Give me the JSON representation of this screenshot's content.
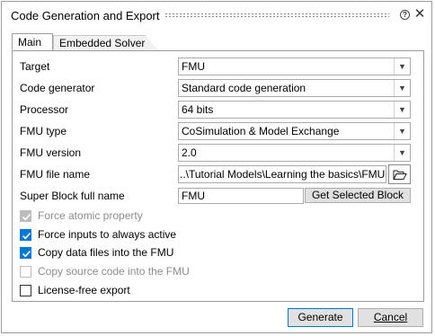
{
  "dialog": {
    "title": "Code Generation and Export",
    "help_icon": "question-circle-icon",
    "close_icon": "close-icon"
  },
  "tabs": [
    {
      "label": "Main",
      "active": true
    },
    {
      "label": "Embedded Solver",
      "active": false
    }
  ],
  "fields": {
    "target": {
      "label": "Target",
      "value": "FMU"
    },
    "code_generator": {
      "label": "Code generator",
      "value": "Standard code generation"
    },
    "processor": {
      "label": "Processor",
      "value": "64 bits"
    },
    "fmu_type": {
      "label": "FMU type",
      "value": "CoSimulation & Model Exchange"
    },
    "fmu_version": {
      "label": "FMU version",
      "value": "2.0"
    },
    "fmu_file_name": {
      "label": "FMU file name",
      "value": "..\\Tutorial Models\\Learning the basics\\FMU.fmu"
    },
    "super_block": {
      "label": "Super Block full name",
      "value": "FMU",
      "button": "Get Selected Block"
    }
  },
  "options": [
    {
      "label": "Force atomic property",
      "checked": true,
      "enabled": false
    },
    {
      "label": "Force inputs to always active",
      "checked": true,
      "enabled": true
    },
    {
      "label": "Copy data files into the FMU",
      "checked": true,
      "enabled": true
    },
    {
      "label": "Copy source code into the FMU",
      "checked": false,
      "enabled": false
    },
    {
      "label": "License-free export",
      "checked": false,
      "enabled": true
    }
  ],
  "footer": {
    "generate": "Generate",
    "cancel": "Cancel"
  },
  "colors": {
    "accent": "#0078d7"
  }
}
